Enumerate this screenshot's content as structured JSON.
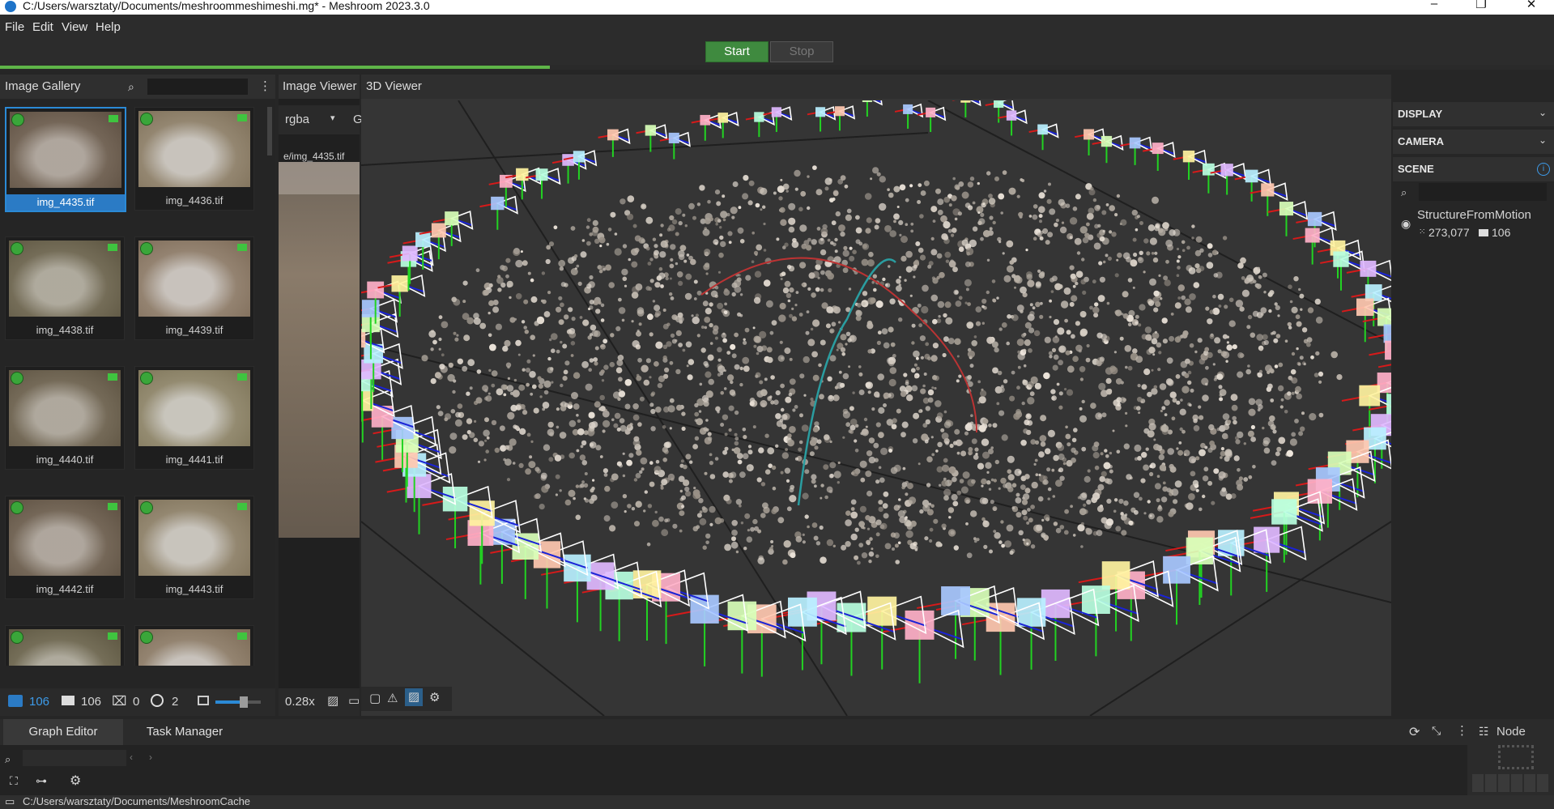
{
  "window": {
    "title": "C:/Users/warsztaty/Documents/meshroommeshimeshi.mg* - Meshroom 2023.3.0",
    "controls": [
      "–",
      "❐",
      "✕"
    ]
  },
  "menu": [
    "File",
    "Edit",
    "View",
    "Help"
  ],
  "actions": {
    "start": "Start",
    "stop": "Stop"
  },
  "progress": {
    "fraction": 0.354
  },
  "gallery": {
    "title": "Image Gallery",
    "items": [
      {
        "name": "img_4435.tif",
        "selected": true
      },
      {
        "name": "img_4436.tif"
      },
      {
        "name": "img_4438.tif"
      },
      {
        "name": "img_4439.tif"
      },
      {
        "name": "img_4440.tif"
      },
      {
        "name": "img_4441.tif"
      },
      {
        "name": "img_4442.tif"
      },
      {
        "name": "img_4443.tif"
      },
      {
        "name": ""
      },
      {
        "name": ""
      }
    ],
    "footer": {
      "images": "106",
      "cameras": "106",
      "no_intrinsics": "0",
      "reconstructed": "2"
    }
  },
  "image_viewer": {
    "title": "Image Viewer",
    "channel": "rgba",
    "extra": "G",
    "path": "e/img_4435.tif",
    "zoom": "0.28x"
  },
  "viewer3d": {
    "title": "3D Viewer"
  },
  "scene_panel": {
    "display": "DISPLAY",
    "camera": "CAMERA",
    "scene": "SCENE",
    "node_name": "StructureFromMotion",
    "points": "273,077",
    "cameras": "106"
  },
  "bottom": {
    "tabs": [
      "Graph Editor",
      "Task Manager"
    ],
    "node_label": "Node",
    "status_path": "C:/Users/warsztaty/Documents/MeshroomCache"
  },
  "colors": {
    "accent": "#2b7bc5",
    "progress": "#5fb548",
    "start_btn": "#3f8a3f"
  }
}
